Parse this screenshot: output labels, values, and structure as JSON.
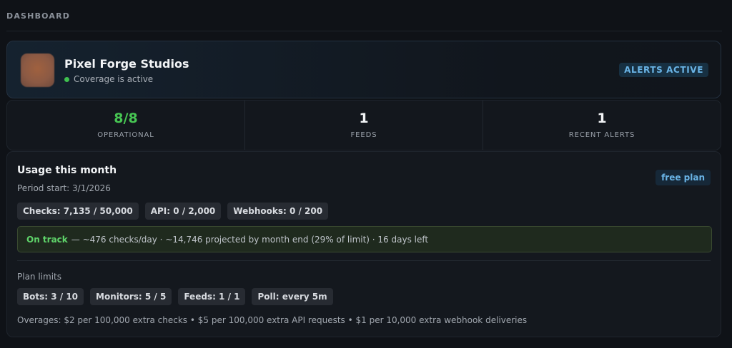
{
  "page": {
    "section_label": "DASHBOARD"
  },
  "org": {
    "name": "Pixel Forge Studios",
    "status_text": "Coverage is active",
    "status_color": "#3fc04f",
    "alerts_badge": "ALERTS ACTIVE"
  },
  "stats": [
    {
      "value": "8/8",
      "label": "OPERATIONAL",
      "color": "#47c653"
    },
    {
      "value": "1",
      "label": "FEEDS"
    },
    {
      "value": "1",
      "label": "RECENT ALERTS"
    }
  ],
  "usage": {
    "title": "Usage this month",
    "period": "Period start: 3/1/2026",
    "plan_badge": "free plan",
    "chips": [
      "Checks: 7,135 / 50,000",
      "API: 0 / 2,000",
      "Webhooks: 0 / 200"
    ],
    "track_status": "On track",
    "track_detail": "— ~476 checks/day · ~14,746 projected by month end (29% of limit) · 16 days left",
    "limits_label": "Plan limits",
    "limits": [
      "Bots: 3 / 10",
      "Monitors: 5 / 5",
      "Feeds: 1 / 1",
      "Poll: every 5m"
    ],
    "overages": "Overages: $2 per 100,000 extra checks • $5 per 100,000 extra API requests • $1 per 10,000 extra webhook deliveries"
  },
  "colors": {
    "accent": "#6ab4e6",
    "success": "#47c653",
    "background": "#0f1217"
  }
}
